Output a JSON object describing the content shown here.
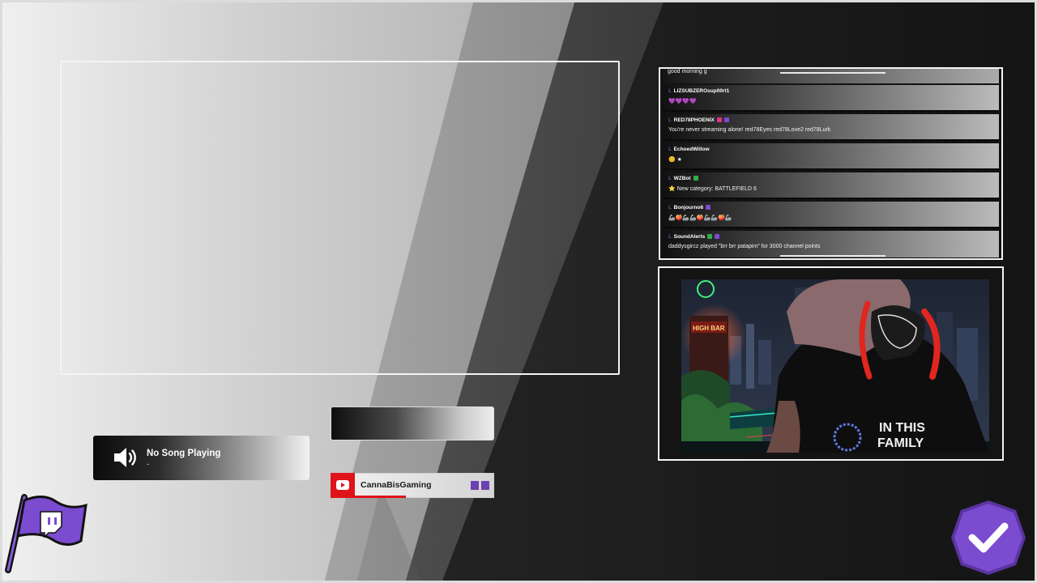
{
  "colors": {
    "accent_purple": "#7b4bd0",
    "youtube_red": "#e0131a",
    "frame_white": "#f4f4f4"
  },
  "chat": {
    "top_message": "good morning g",
    "messages": [
      {
        "user": "LIZSUBZEROsup00rt1",
        "text": "💜💜💜💜",
        "badges": []
      },
      {
        "user": "RED78PHOENIX",
        "text": "You're never streaming alone! red78Eyes red78Love2 red78Lurk",
        "badges": [
          "heart",
          "sub"
        ]
      },
      {
        "user": "EchoedWillow",
        "text": "😊 ★",
        "badges": []
      },
      {
        "user": "WZBot",
        "text": "⭐ New category: BATTLEFIELD 6",
        "badges": [
          "check"
        ]
      },
      {
        "user": "Bonjourno6",
        "text": "🦾🍑🦾🦾🍑🦾🦾🍑🦾",
        "badges": [
          "sub"
        ]
      },
      {
        "user": "SoundAlerts",
        "text": "daddysgircz played \"brr brr patapim\" for 3000 channel points",
        "badges": [
          "check",
          "sub"
        ]
      }
    ]
  },
  "webcam": {
    "sign_text": "HIGH BAR",
    "shirt_line1": "IN THIS",
    "shirt_line2": "FAMILY"
  },
  "now_playing": {
    "title": "No Song Playing",
    "subtitle": "-",
    "icon": "speaker-icon"
  },
  "youtube": {
    "channel_name": "CannaBisGaming",
    "icon": "youtube-icon"
  },
  "logos": {
    "flag": "twitch-flag-icon",
    "check": "check-badge-icon"
  }
}
